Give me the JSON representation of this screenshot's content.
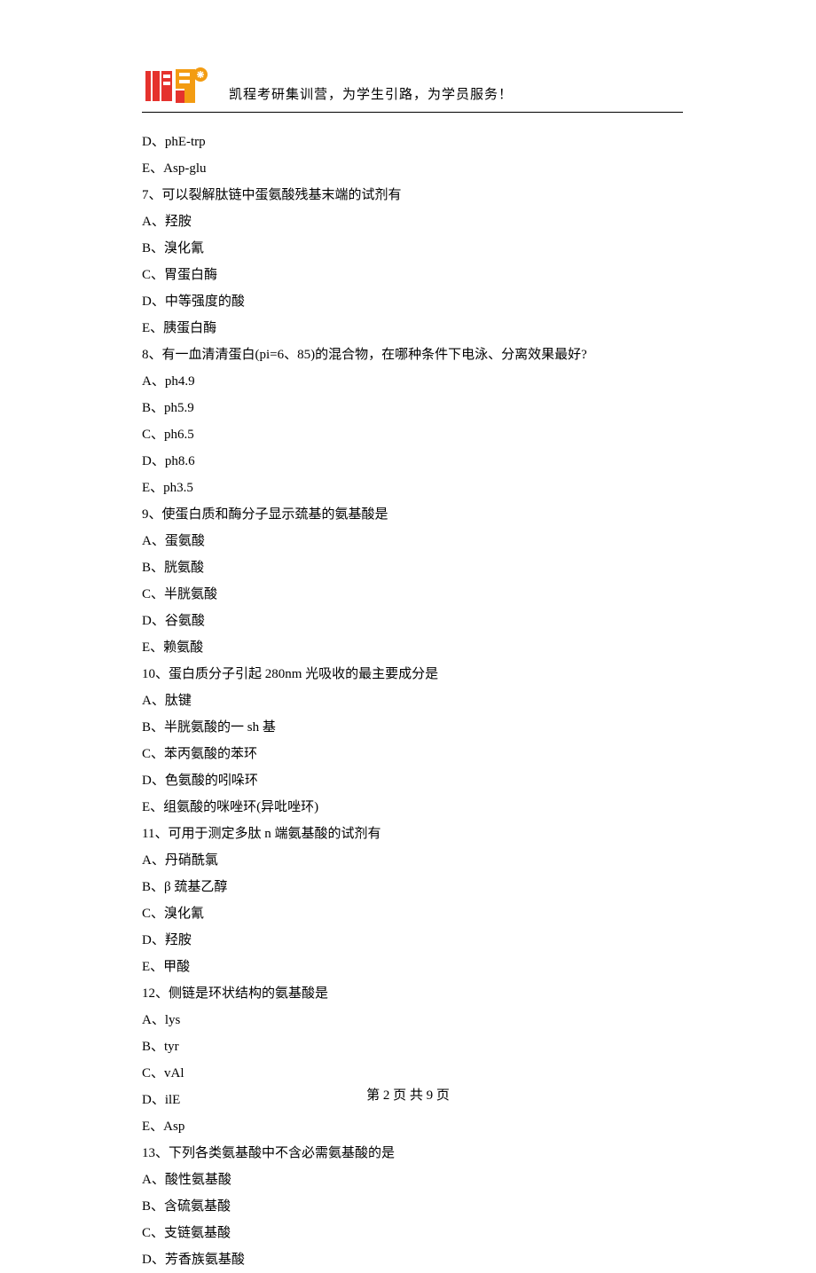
{
  "header": {
    "tagline": "凯程考研集训营，为学生引路，为学员服务！"
  },
  "lines": [
    "D、phE-trp",
    "E、Asp-glu",
    "7、可以裂解肽链中蛋氨酸残基末端的试剂有",
    "A、羟胺",
    "B、溴化氰",
    "C、胃蛋白酶",
    "D、中等强度的酸",
    "E、胰蛋白酶",
    "8、有一血清清蛋白(pi=6、85)的混合物，在哪种条件下电泳、分离效果最好?",
    "A、ph4.9",
    "B、ph5.9",
    "C、ph6.5",
    "D、ph8.6",
    "E、ph3.5",
    "9、使蛋白质和酶分子显示巯基的氨基酸是",
    "A、蛋氨酸",
    "B、胱氨酸",
    "C、半胱氨酸",
    "D、谷氨酸",
    "E、赖氨酸",
    "10、蛋白质分子引起 280nm 光吸收的最主要成分是",
    "A、肽键",
    "B、半胱氨酸的一 sh 基",
    "C、苯丙氨酸的苯环",
    "D、色氨酸的吲哚环",
    "E、组氨酸的咪唑环(异吡唑环)",
    "11、可用于测定多肽 n 端氨基酸的试剂有",
    "A、丹硝酰氯",
    "B、β 巯基乙醇",
    "C、溴化氰",
    "D、羟胺",
    "E、甲酸",
    "12、侧链是环状结构的氨基酸是",
    "A、lys",
    "B、tyr",
    "C、vAl",
    "D、ilE",
    "E、Asp",
    "13、下列各类氨基酸中不含必需氨基酸的是",
    "A、酸性氨基酸",
    "B、含硫氨基酸",
    "C、支链氨基酸",
    "D、芳香族氨基酸"
  ],
  "footer": {
    "text": "第 2 页 共 9 页"
  }
}
